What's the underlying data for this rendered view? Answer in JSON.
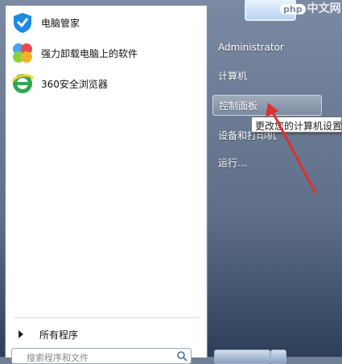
{
  "start_menu": {
    "programs": [
      {
        "label": "电脑管家",
        "icon": "tencent-pc-manager-icon"
      },
      {
        "label": "强力卸载电脑上的软件",
        "icon": "uninstall-software-icon"
      },
      {
        "label": "360安全浏览器",
        "icon": "360-browser-icon"
      }
    ],
    "all_programs_label": "所有程序",
    "search": {
      "placeholder": "搜索程序和文件"
    }
  },
  "right_panel": {
    "items": [
      {
        "label": "Administrator"
      },
      {
        "label": "计算机"
      },
      {
        "label": "控制面板"
      },
      {
        "label": "设备和打印机"
      },
      {
        "label": "运行..."
      }
    ]
  },
  "tooltip": {
    "text": "更改您的计算机设置"
  },
  "watermark": {
    "badge": "php",
    "text": "中文网"
  },
  "colors": {
    "annotation_arrow": "#e03030",
    "panel_bg": "#5f6f88",
    "highlight": "#ffffff"
  }
}
